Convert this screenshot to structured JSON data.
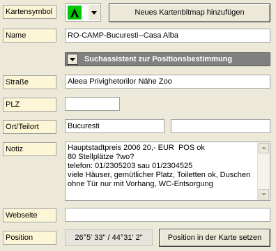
{
  "labels": {
    "symbol": "Kartensymbol",
    "name": "Name",
    "street": "Straße",
    "zip": "PLZ",
    "city": "Ort/Teilort",
    "note": "Notiz",
    "website": "Webseite",
    "position": "Position"
  },
  "symbol": {
    "icon": "tent-icon",
    "dropdown_icon": "chevron-down-icon"
  },
  "buttons": {
    "new_bitmap": "Neues Kartenbitmap hinzufügen",
    "search_assistant": "Suchassistent zur Positionsbestimmung",
    "set_position": "Position in der Karte setzen"
  },
  "fields": {
    "name": "RO-CAMP-Bucuresti--Casa Alba",
    "street": "Aleea Privighetorilor Nähe Zoo",
    "zip": "",
    "city": "Bucuresti",
    "district": "",
    "note": "Hauptstadtpreis 2006 20,- EUR  POS ok\n80 Stellplätze ?wo?\ntelefon: 01/2305203 sau 01/2304525\nviele Häuser, gemütlicher Platz, Toiletten ok, Duschen ohne Tür nur mit Vorhang, WC-Entsorgung",
    "website": "",
    "position": "26°5' 33\" / 44°31' 2\""
  },
  "colors": {
    "background": "#ece9d8",
    "label_bg": "#fdf6d6",
    "symbol_green": "#00c800",
    "search_bar_bg": "#808080"
  }
}
